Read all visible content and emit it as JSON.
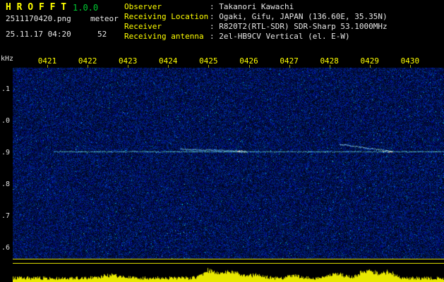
{
  "header": {
    "app_title": "H R O F F T",
    "version": "1.0.0",
    "filename": "2511170420.png",
    "mode": "meteor",
    "datetime": "25.11.17 04:20",
    "echo_count": "52",
    "station_info": [
      {
        "label": "Observer",
        "value": ": Takanori Kawachi"
      },
      {
        "label": "Receiving Location",
        "value": ": Ogaki, Gifu, JAPAN (136.60E, 35.35N)"
      },
      {
        "label": "Receiver",
        "value": ": R820T2(RTL-SDR) SDR-Sharp 53.1000MHz"
      },
      {
        "label": "Receiving antenna",
        "value": ": 2el-HB9CV Vertical (el. E-W)"
      }
    ]
  },
  "chart_data": {
    "type": "heatmap",
    "title": "HROFFT radio meteor echo spectrogram, 10-minute window starting 04:20",
    "x_tick_labels": [
      "0421",
      "0422",
      "0423",
      "0424",
      "0425",
      "0426",
      "0427",
      "0428",
      "0429",
      "0430"
    ],
    "x_range": [
      "04:20",
      "04:30"
    ],
    "y_axis_unit": "kHz",
    "y_tick_labels": [
      ".1",
      ".0",
      ".9",
      ".8",
      ".7",
      ".6"
    ],
    "y_tick_values_khz": [
      1.1,
      1.0,
      0.9,
      0.8,
      0.7,
      0.6
    ],
    "y_range_khz": [
      0.56,
      1.17
    ],
    "grid": false,
    "legend": "none",
    "carrier_line": {
      "frequency_khz": 0.905,
      "start_minute": 1.15
    },
    "echoes": [
      {
        "t_start_min": 4.3,
        "t_end_min": 5.95,
        "f_start_khz": 0.913,
        "f_end_khz": 0.906
      },
      {
        "t_start_min": 8.25,
        "t_end_min": 9.55,
        "f_start_khz": 0.928,
        "f_end_khz": 0.906
      }
    ],
    "power_bursts": [
      {
        "minute": 2.55,
        "amp": 5,
        "width": 0.45
      },
      {
        "minute": 5.0,
        "amp": 13,
        "width": 0.3
      },
      {
        "minute": 5.55,
        "amp": 11,
        "width": 0.45
      },
      {
        "minute": 6.2,
        "amp": 6,
        "width": 0.3
      },
      {
        "minute": 7.1,
        "amp": 5,
        "width": 0.25
      },
      {
        "minute": 8.15,
        "amp": 8,
        "width": 0.35
      },
      {
        "minute": 8.95,
        "amp": 13,
        "width": 0.4
      },
      {
        "minute": 9.45,
        "amp": 11,
        "width": 0.3
      }
    ],
    "colors": {
      "background_noise": "#000a33",
      "time_label": "#ffff00",
      "freq_label": "#e0e0e0",
      "carrier": "#80ffee",
      "threshold_line": "#d8d800",
      "power_bar": "#e8e800",
      "title_yellow": "#ffff00",
      "version_green": "#00cc33",
      "text_white": "#e8e8e8"
    }
  }
}
